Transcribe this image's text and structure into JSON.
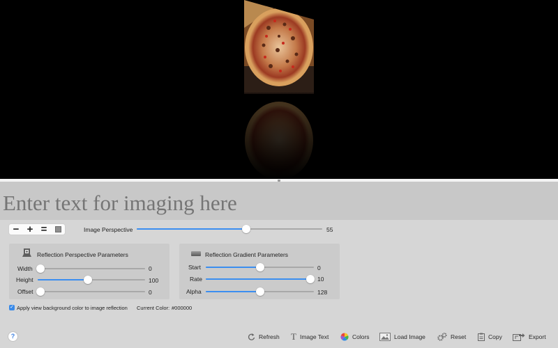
{
  "preview": {
    "background_color": "#000000",
    "image_subject": "pizza"
  },
  "text_entry": {
    "placeholder": "Enter text for imaging here",
    "value": ""
  },
  "zoom_controls": {
    "buttons": [
      {
        "name": "zoom-out",
        "glyph": "−"
      },
      {
        "name": "zoom-in",
        "glyph": "+"
      },
      {
        "name": "actual-size",
        "glyph": "="
      },
      {
        "name": "fit-image",
        "glyph": ""
      }
    ]
  },
  "image_perspective": {
    "label": "Image Perspective",
    "value": 55,
    "value_text": "55",
    "fraction": 0.59
  },
  "reflection_perspective": {
    "title": "Reflection Perspective Parameters",
    "icon": "reflection-icon",
    "sliders": [
      {
        "label": "Width",
        "value_text": "0",
        "fraction": 0.0
      },
      {
        "label": "Height",
        "value_text": "100",
        "fraction": 0.47
      },
      {
        "label": "Offset",
        "value_text": "0",
        "fraction": 0.0
      }
    ]
  },
  "reflection_gradient": {
    "title": "Reflection Gradient Parameters",
    "icon": "gradient-icon",
    "sliders": [
      {
        "label": "Start",
        "value_text": "0",
        "fraction": 0.5
      },
      {
        "label": "Rate",
        "value_text": "10",
        "fraction": 1.0
      },
      {
        "label": "Alpha",
        "value_text": "128",
        "fraction": 0.5
      }
    ]
  },
  "options": {
    "apply_background_label": "Apply view background color to image reflection",
    "apply_background_checked": true,
    "current_color_label": "Current Color:",
    "current_color_value": "#000000"
  },
  "toolbar": {
    "help_glyph": "?",
    "buttons": [
      {
        "label": "Refresh",
        "icon": "refresh-icon"
      },
      {
        "label": "Image Text",
        "icon": "text-icon"
      },
      {
        "label": "Colors",
        "icon": "colors-icon"
      },
      {
        "label": "Load Image",
        "icon": "image-icon"
      },
      {
        "label": "Reset",
        "icon": "gears-icon"
      },
      {
        "label": "Copy",
        "icon": "clipboard-icon"
      },
      {
        "label": "Export",
        "icon": "export-icon"
      }
    ]
  },
  "colors": {
    "accent": "#3b8ef0",
    "window_bg": "#d6d6d6",
    "panel_bg": "#cbcbcb",
    "text_field_bg": "#c8c8c8"
  }
}
